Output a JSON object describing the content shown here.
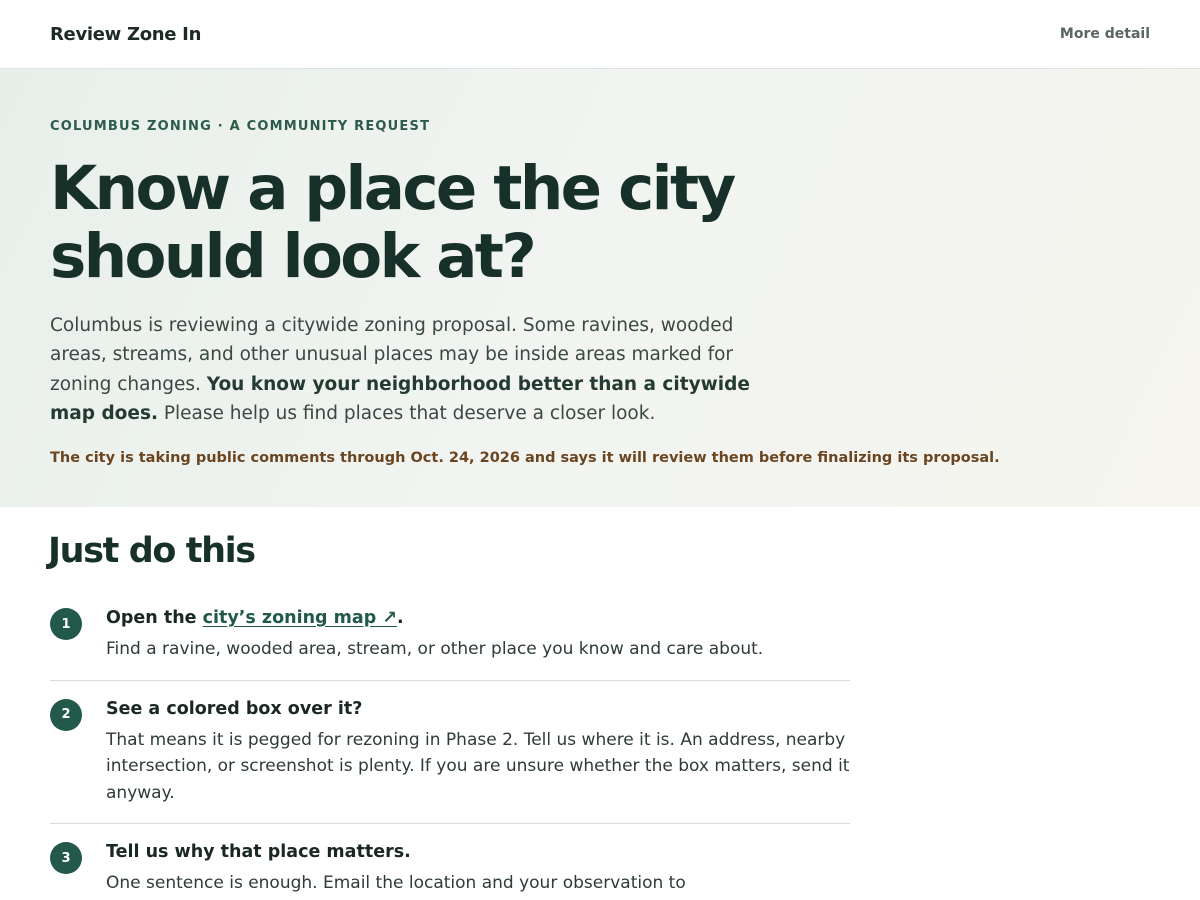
{
  "header": {
    "brand": "Review Zone In",
    "nav_link": "More detail"
  },
  "hero": {
    "eyebrow": "COLUMBUS ZONING · A COMMUNITY REQUEST",
    "title": "Know a place the city should look at?",
    "intro_lead": "Columbus is reviewing a citywide zoning proposal. Some ravines, wooded areas, streams, and other unusual places may be inside areas marked for zoning changes.",
    "intro_strong": "You know your neighborhood better than a citywide map does.",
    "intro_tail": "Please help us find places that deserve a closer look.",
    "deadline": "The city is taking public comments through Oct. 24, 2026 and says it will review them before finalizing its proposal."
  },
  "steps_section": {
    "title": "Just do this",
    "steps": [
      {
        "number": "1",
        "title_before": "Open the",
        "link_label": "city’s zoning map ↗",
        "title_after": ".",
        "text": "Find a ravine, wooded area, stream, or other place you know and care about."
      },
      {
        "number": "2",
        "title": "See a colored box over it?",
        "text": "That means it is pegged for rezoning in Phase 2. Tell us where it is. An address, nearby intersection, or screenshot is plenty. If you are unsure whether the box matters, send it anyway."
      },
      {
        "number": "3",
        "title": "Tell us why that place matters.",
        "text": "One sentence is enough. Email the location and your observation to"
      }
    ]
  },
  "colors": {
    "accent": "#22594a",
    "heading": "#17312a",
    "deadline": "#6b4520"
  }
}
